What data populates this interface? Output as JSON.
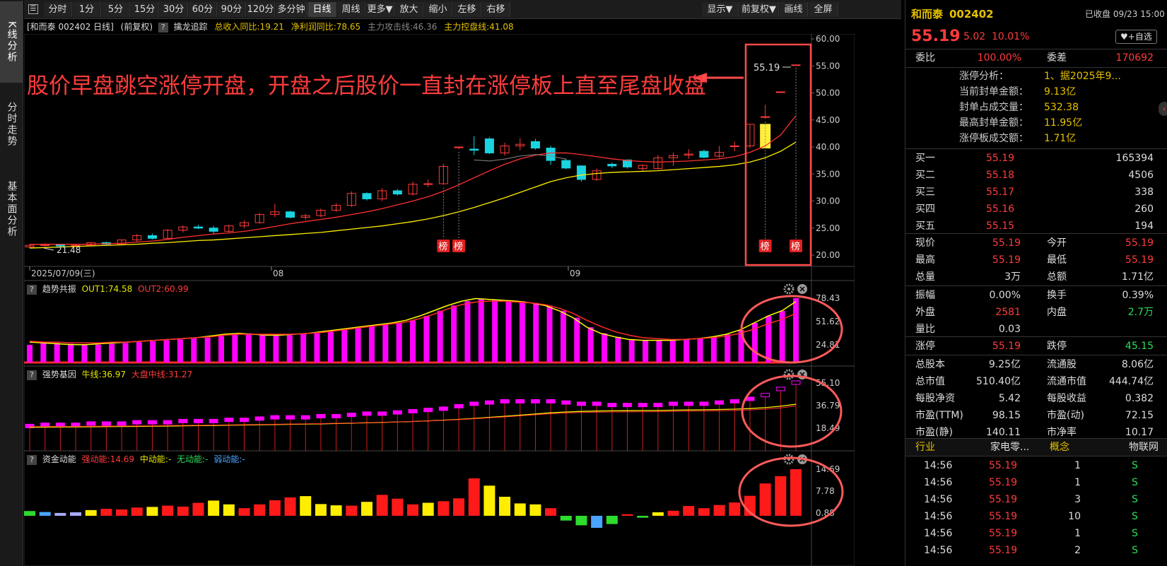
{
  "left_tabs": [
    "K线分析",
    "分时走势",
    "基本面分析"
  ],
  "toolbar": [
    "分时",
    "1分",
    "5分",
    "15分",
    "30分",
    "60分",
    "90分",
    "120分",
    "多分钟",
    "日线",
    "周线",
    "更多▼",
    "放大",
    "缩小",
    "左移",
    "右移",
    "显示▼",
    "前复权▼",
    "画线",
    "全屏"
  ],
  "toolbar_active": "日线",
  "infobar": {
    "stock": "[和而泰 002402 日线]",
    "adj": "(前复权)",
    "q": "?",
    "indicator": "擒龙追踪",
    "revenue": "总收入同比:19.21",
    "profit": "净利润同比:78.65",
    "attack": "主力攻击线:46.36",
    "control": "主力控盘线:41.08"
  },
  "annotation": "股价早盘跳空涨停开盘，开盘之后股价一直封在涨停板上直至尾盘收盘",
  "main_chart": {
    "y_ticks": [
      "60.00",
      "55.00",
      "50.00",
      "45.00",
      "40.00",
      "35.00",
      "30.00",
      "25.00",
      "20.00"
    ],
    "x_labels": [
      "2025/07/09(三)",
      "08",
      "09"
    ],
    "low_label": "21.48",
    "last_price_label": "55.19",
    "bang_label": "榜"
  },
  "panel1": {
    "name": "趋势共振",
    "out1": "OUT1:74.58",
    "out2": "OUT2:60.99",
    "ticks": [
      "78.43",
      "51.62",
      "24.81"
    ]
  },
  "panel2": {
    "name": "强势基因",
    "bull": "牛线:36.97",
    "market": "大盘中线:31.27",
    "ticks": [
      "55.10",
      "36.79",
      "18.49"
    ]
  },
  "panel3": {
    "name": "资金动能",
    "strong": "强动能:14.69",
    "mid": "中动能:-",
    "none": "无动能:-",
    "weak": "弱动能:-",
    "ticks": [
      "14.69",
      "7.78",
      "0.88"
    ]
  },
  "chart_data": {
    "type": "candlestick",
    "days": 37,
    "ohlc": [
      [
        21.5,
        22.0,
        21.3,
        21.8
      ],
      [
        21.8,
        22.2,
        21.6,
        21.9
      ],
      [
        21.9,
        22.1,
        21.5,
        21.7
      ],
      [
        21.7,
        22.0,
        21.6,
        21.8
      ],
      [
        21.8,
        22.4,
        21.7,
        22.3
      ],
      [
        22.3,
        22.5,
        21.9,
        22.0
      ],
      [
        22.0,
        22.9,
        21.9,
        22.8
      ],
      [
        22.8,
        23.9,
        22.5,
        23.6
      ],
      [
        23.6,
        24.0,
        22.9,
        23.1
      ],
      [
        23.1,
        24.8,
        23.0,
        24.6
      ],
      [
        24.6,
        25.5,
        24.2,
        25.2
      ],
      [
        25.2,
        25.6,
        24.8,
        25.0
      ],
      [
        25.0,
        25.4,
        24.0,
        24.4
      ],
      [
        24.4,
        25.6,
        24.2,
        25.4
      ],
      [
        25.4,
        26.4,
        25.0,
        26.0
      ],
      [
        26.0,
        27.8,
        25.8,
        27.5
      ],
      [
        27.5,
        29.5,
        27.0,
        28.0
      ],
      [
        28.0,
        28.2,
        26.8,
        27.0
      ],
      [
        27.0,
        27.6,
        26.5,
        27.3
      ],
      [
        27.3,
        28.6,
        27.0,
        28.3
      ],
      [
        28.3,
        29.6,
        28.0,
        29.2
      ],
      [
        29.2,
        31.8,
        28.9,
        31.4
      ],
      [
        31.4,
        31.6,
        30.1,
        30.4
      ],
      [
        30.4,
        32.4,
        30.0,
        31.9
      ],
      [
        31.9,
        32.2,
        31.0,
        31.3
      ],
      [
        31.3,
        33.6,
        31.0,
        33.1
      ],
      [
        33.1,
        34.0,
        32.6,
        33.2
      ],
      [
        33.2,
        36.9,
        33.0,
        36.4
      ],
      [
        40.0,
        40.1,
        39.6,
        40.0
      ],
      [
        39.6,
        42.0,
        38.5,
        39.4
      ],
      [
        41.5,
        41.8,
        38.7,
        38.9
      ],
      [
        38.9,
        40.8,
        38.4,
        40.2
      ],
      [
        40.2,
        41.6,
        39.4,
        40.5
      ],
      [
        41.0,
        41.5,
        39.5,
        39.8
      ],
      [
        39.8,
        40.2,
        36.7,
        37.5
      ],
      [
        37.5,
        37.8,
        35.9,
        36.1
      ],
      [
        36.5,
        36.6,
        33.6,
        34.0
      ]
    ],
    "ohlc_tail": [
      [
        34.0,
        36.0,
        33.7,
        35.6
      ],
      [
        36.8,
        37.1,
        36.1,
        36.5
      ],
      [
        37.6,
        37.7,
        36.0,
        36.3
      ],
      [
        36.0,
        36.8,
        35.5,
        36.6
      ],
      [
        36.0,
        38.5,
        35.8,
        38.0
      ],
      [
        38.0,
        39.0,
        36.5,
        38.4
      ],
      [
        38.5,
        39.6,
        37.8,
        38.7
      ],
      [
        39.2,
        39.5,
        37.9,
        38.1
      ],
      [
        38.3,
        40.2,
        38.0,
        39.0
      ],
      [
        40.1,
        41.0,
        39.2,
        40.2
      ],
      [
        40.2,
        44.2,
        39.8,
        44.2
      ],
      [
        45.6,
        47.8,
        45.2,
        45.6
      ],
      [
        50.2,
        50.2,
        50.2,
        50.2
      ],
      [
        55.19,
        55.19,
        55.19,
        55.19
      ]
    ],
    "ma_red": [
      22.0,
      22.0,
      22.0,
      22.0,
      22.0,
      22.1,
      22.2,
      22.4,
      22.6,
      22.9,
      23.3,
      23.6,
      23.9,
      24.1,
      24.4,
      24.8,
      25.3,
      25.8,
      26.2,
      26.6,
      27.0,
      27.5,
      28.0,
      28.6,
      29.3,
      30.0,
      30.8,
      31.8,
      33.0,
      34.3,
      35.6,
      36.8,
      37.8,
      38.5,
      38.9,
      38.9,
      38.6,
      38.2,
      37.8,
      37.5,
      37.3,
      37.2,
      37.3,
      37.4,
      37.6,
      37.8,
      38.2,
      39.0,
      40.2,
      42.2,
      45.8
    ],
    "ma_yellow": [
      21.3,
      21.4,
      21.5,
      21.6,
      21.7,
      21.8,
      21.9,
      22.0,
      22.2,
      22.3,
      22.5,
      22.7,
      22.8,
      23.0,
      23.2,
      23.4,
      23.6,
      23.8,
      24.0,
      24.2,
      24.5,
      24.8,
      25.1,
      25.4,
      25.8,
      26.2,
      26.7,
      27.3,
      28.0,
      28.8,
      29.7,
      30.6,
      31.6,
      32.6,
      33.6,
      34.3,
      34.8,
      35.1,
      35.3,
      35.4,
      35.5,
      35.6,
      35.8,
      36.0,
      36.2,
      36.4,
      36.7,
      37.2,
      38.0,
      39.2,
      40.9
    ],
    "osc1_bars": [
      24.81,
      28,
      27,
      26,
      25,
      25,
      26,
      27,
      28,
      29,
      30,
      31,
      32,
      33,
      35,
      37,
      38,
      37,
      36,
      36,
      37,
      38,
      40,
      42,
      44,
      46,
      48,
      50,
      53,
      58,
      64,
      70,
      75,
      78,
      77,
      76,
      75,
      73,
      70,
      64,
      56,
      45,
      38,
      34,
      31,
      30,
      30,
      30,
      31,
      32,
      34,
      37,
      42,
      50,
      58,
      64,
      78.43
    ],
    "osc1_out1": [
      28,
      27,
      26,
      25,
      25,
      26,
      27,
      28,
      29,
      30,
      31,
      32,
      33,
      35,
      37,
      38,
      37,
      36,
      36,
      37,
      38,
      40,
      42,
      44,
      46,
      48,
      50,
      53,
      58,
      64,
      70,
      75,
      78,
      77,
      76,
      75,
      73,
      70,
      64,
      56,
      45,
      38,
      34,
      31,
      30,
      30,
      30,
      31,
      32,
      34,
      37,
      42,
      50,
      58,
      64,
      74.58
    ],
    "osc1_out2": [
      29,
      28,
      28,
      27,
      27,
      27,
      28,
      28,
      29,
      30,
      31,
      32,
      33,
      34,
      36,
      37,
      37,
      37,
      37,
      37,
      38,
      39,
      41,
      43,
      45,
      47,
      49,
      51,
      55,
      60,
      66,
      71,
      74,
      75,
      75,
      74,
      73,
      71,
      67,
      61,
      53,
      46,
      40,
      36,
      33,
      32,
      31,
      31,
      32,
      33,
      35,
      38,
      43,
      49,
      54,
      60.99
    ],
    "osc2_candles": [
      20,
      21,
      21,
      21,
      22,
      22,
      22,
      23,
      23,
      23,
      24,
      24,
      24,
      25,
      25,
      26,
      27,
      27,
      27,
      28,
      28,
      29,
      30,
      30,
      31,
      32,
      33,
      34,
      36,
      38,
      39,
      40,
      40,
      40,
      40,
      39,
      38,
      38,
      37,
      37,
      37,
      37,
      38,
      38,
      38,
      39,
      40,
      42,
      45,
      50,
      55.1
    ],
    "osc2_bull": 36.97,
    "osc2_market": 31.27,
    "osc3_bars": [
      1.5,
      1.2,
      0.9,
      1.1,
      1.8,
      2.2,
      2.0,
      2.6,
      2.8,
      3.2,
      2.9,
      4.1,
      4.8,
      3.6,
      2.4,
      3.6,
      4.9,
      5.8,
      6.2,
      3.7,
      3.3,
      3.2,
      4.4,
      6.6,
      5.4,
      3.6,
      4.1,
      4.6,
      5.5,
      11.8,
      9.5,
      6.0,
      3.9,
      3.6,
      2.4,
      -1.5,
      -3.0,
      -3.8,
      -2.6,
      0.5,
      -0.6,
      1.1,
      1.6,
      3.1,
      2.4,
      3.4,
      4.2,
      6.3,
      10.2,
      12.5,
      14.69
    ]
  },
  "right": {
    "name": "和而泰",
    "code": "002402",
    "status": "已收盘 09/23 15:00",
    "price": "55.19",
    "change": "5.02",
    "pct": "10.01%",
    "fav": "♥+自选",
    "weibi_label": "委比",
    "weibi": "100.00%",
    "weicha_label": "委差",
    "weicha": "170692",
    "limit_rows": [
      {
        "k": "涨停分析：",
        "v": "1、据2025年9..."
      },
      {
        "k": "当前封单金额：",
        "v": "9.13亿"
      },
      {
        "k": "封单占成交量：",
        "v": "532.38"
      },
      {
        "k": "最高封单金额：",
        "v": "11.95亿"
      },
      {
        "k": "涨停板成交额：",
        "v": "1.71亿"
      }
    ],
    "bids": [
      {
        "k": "买一",
        "p": "55.19",
        "v": "165394"
      },
      {
        "k": "买二",
        "p": "55.18",
        "v": "4506"
      },
      {
        "k": "买三",
        "p": "55.17",
        "v": "338"
      },
      {
        "k": "买四",
        "p": "55.16",
        "v": "260"
      },
      {
        "k": "买五",
        "p": "55.15",
        "v": "194"
      }
    ],
    "stats1": [
      {
        "k1": "现价",
        "v1": "55.19",
        "c1": "red",
        "k2": "今开",
        "v2": "55.19",
        "c2": "red"
      },
      {
        "k1": "最高",
        "v1": "55.19",
        "c1": "red",
        "k2": "最低",
        "v2": "55.19",
        "c2": "red"
      },
      {
        "k1": "总量",
        "v1": "3万",
        "c1": "white",
        "k2": "总额",
        "v2": "1.71亿",
        "c2": "white"
      }
    ],
    "stats2": [
      {
        "k1": "振幅",
        "v1": "0.00%",
        "c1": "white",
        "k2": "换手",
        "v2": "0.39%",
        "c2": "white"
      },
      {
        "k1": "外盘",
        "v1": "2581",
        "c1": "red",
        "k2": "内盘",
        "v2": "2.7万",
        "c2": "green"
      },
      {
        "k1": "量比",
        "v1": "0.03",
        "c1": "white",
        "k2": "",
        "v2": "",
        "c2": "white"
      }
    ],
    "stats3": [
      {
        "k1": "涨停",
        "v1": "55.19",
        "c1": "red",
        "k2": "跌停",
        "v2": "45.15",
        "c2": "green"
      }
    ],
    "stats4": [
      {
        "k1": "总股本",
        "v1": "9.25亿",
        "k2": "流通股",
        "v2": "8.06亿"
      },
      {
        "k1": "总市值",
        "v1": "510.40亿",
        "k2": "流通市值",
        "v2": "444.74亿"
      },
      {
        "k1": "每股净资",
        "v1": "5.42",
        "k2": "每股收益",
        "v2": "0.382"
      },
      {
        "k1": "市盈(TTM)",
        "v1": "98.15",
        "k2": "市盈(动)",
        "v2": "72.15"
      },
      {
        "k1": "市盈(静)",
        "v1": "140.11",
        "k2": "市净率",
        "v2": "10.17"
      }
    ],
    "industry_label": "行业",
    "industry": "家电零...",
    "concept_label": "概念",
    "concept": "物联网",
    "ticks": [
      {
        "t": "14:56",
        "p": "55.19",
        "v": "1",
        "s": "S"
      },
      {
        "t": "14:56",
        "p": "55.19",
        "v": "1",
        "s": "S"
      },
      {
        "t": "14:56",
        "p": "55.19",
        "v": "3",
        "s": "S"
      },
      {
        "t": "14:56",
        "p": "55.19",
        "v": "10",
        "s": "S"
      },
      {
        "t": "14:56",
        "p": "55.19",
        "v": "1",
        "s": "S"
      },
      {
        "t": "14:56",
        "p": "55.19",
        "v": "2",
        "s": "S"
      }
    ]
  }
}
